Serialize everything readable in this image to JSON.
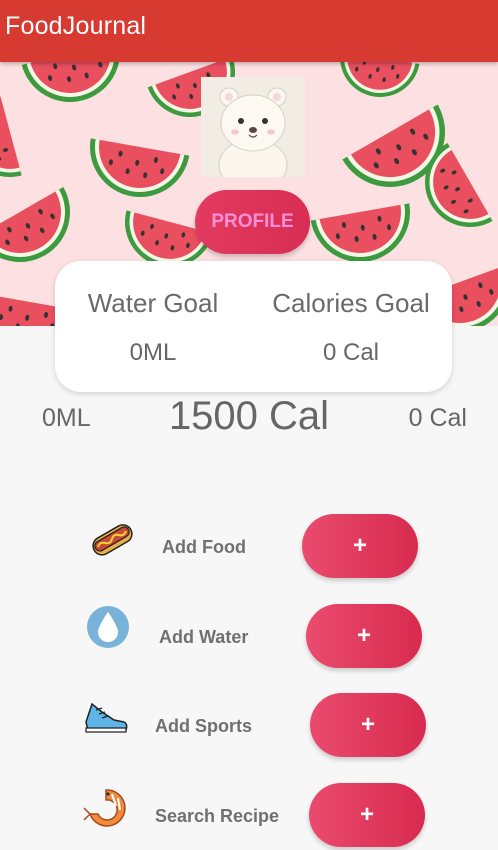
{
  "app": {
    "title": "FoodJournal"
  },
  "profile": {
    "button_label": "PROFILE"
  },
  "goals": {
    "water_label": "Water Goal",
    "water_value": "0ML",
    "calories_label": "Calories Goal",
    "calories_value": "0 Cal"
  },
  "stats": {
    "water_consumed": "0ML",
    "calorie_target": "1500 Cal",
    "calories_consumed": "0 Cal"
  },
  "actions": [
    {
      "label": "Add Food",
      "icon": "hotdog-icon",
      "button_label": "+"
    },
    {
      "label": "Add Water",
      "icon": "water-drop-icon",
      "button_label": "+"
    },
    {
      "label": "Add Sports",
      "icon": "sneaker-icon",
      "button_label": "+"
    },
    {
      "label": "Search Recipe",
      "icon": "shrimp-icon",
      "button_label": "+"
    }
  ],
  "colors": {
    "appbar": "#d63a30",
    "banner_bg": "#fde0e2",
    "button_gradient_start": "#ea4b6e",
    "button_gradient_end": "#d72b4f",
    "profile_text": "#ff8fd6"
  }
}
